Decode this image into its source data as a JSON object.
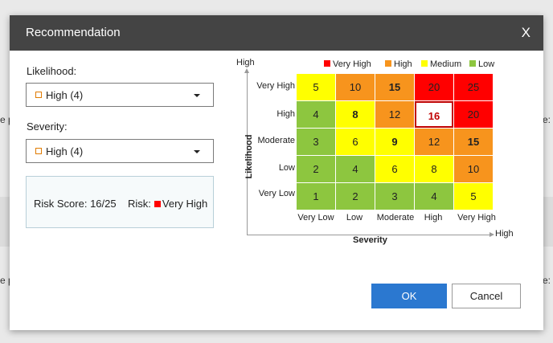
{
  "background": {
    "fragments": [
      {
        "text": "e p",
        "side": "left",
        "row": 1
      },
      {
        "text": "e:",
        "side": "right",
        "row": 1
      },
      {
        "text": "e p",
        "side": "left",
        "row": 2
      },
      {
        "text": "e:",
        "side": "right",
        "row": 2
      }
    ]
  },
  "dialog": {
    "title": "Recommendation",
    "close_label": "X",
    "likelihood_label": "Likelihood:",
    "likelihood_value": "High (4)",
    "severity_label": "Severity:",
    "severity_value": "High (4)",
    "score_text": "Risk Score:  16/25",
    "risk_prefix": "Risk:",
    "risk_level": "Very High",
    "ok_label": "OK",
    "cancel_label": "Cancel"
  },
  "chart": {
    "legend": [
      {
        "label": "Very High",
        "color": "#ff0000"
      },
      {
        "label": "High",
        "color": "#f7941d"
      },
      {
        "label": "Medium",
        "color": "#ffff00"
      },
      {
        "label": "Low",
        "color": "#8dc63f"
      }
    ],
    "y_axis_top": "High",
    "y_axis_title": "Likelihood",
    "x_axis_right": "High",
    "x_axis_title": "Severity",
    "row_labels": [
      "Very High",
      "High",
      "Moderate",
      "Low",
      "Very Low"
    ],
    "col_labels": [
      "Very Low",
      "Low",
      "Moderate",
      "High",
      "Very High"
    ]
  },
  "chart_data": {
    "type": "heatmap",
    "rows": [
      "Very High",
      "High",
      "Moderate",
      "Low",
      "Very Low"
    ],
    "columns": [
      "Very Low",
      "Low",
      "Moderate",
      "High",
      "Very High"
    ],
    "values": [
      [
        5,
        10,
        15,
        20,
        25
      ],
      [
        4,
        8,
        12,
        16,
        20
      ],
      [
        3,
        6,
        9,
        12,
        15
      ],
      [
        2,
        4,
        6,
        8,
        10
      ],
      [
        1,
        2,
        3,
        4,
        5
      ]
    ],
    "levels": [
      [
        "Medium",
        "High",
        "High",
        "Very High",
        "Very High"
      ],
      [
        "Low",
        "Medium",
        "High",
        "Very High",
        "Very High"
      ],
      [
        "Low",
        "Medium",
        "Medium",
        "High",
        "High"
      ],
      [
        "Low",
        "Low",
        "Medium",
        "Medium",
        "High"
      ],
      [
        "Low",
        "Low",
        "Low",
        "Low",
        "Medium"
      ]
    ],
    "bold_cells": [
      [
        0,
        2
      ],
      [
        1,
        1
      ],
      [
        2,
        2
      ],
      [
        2,
        4
      ]
    ],
    "selected": {
      "row": 1,
      "col": 3
    },
    "level_colors": {
      "Very High": "#ff0000",
      "High": "#f7941d",
      "Medium": "#ffff00",
      "Low": "#8dc63f"
    }
  }
}
